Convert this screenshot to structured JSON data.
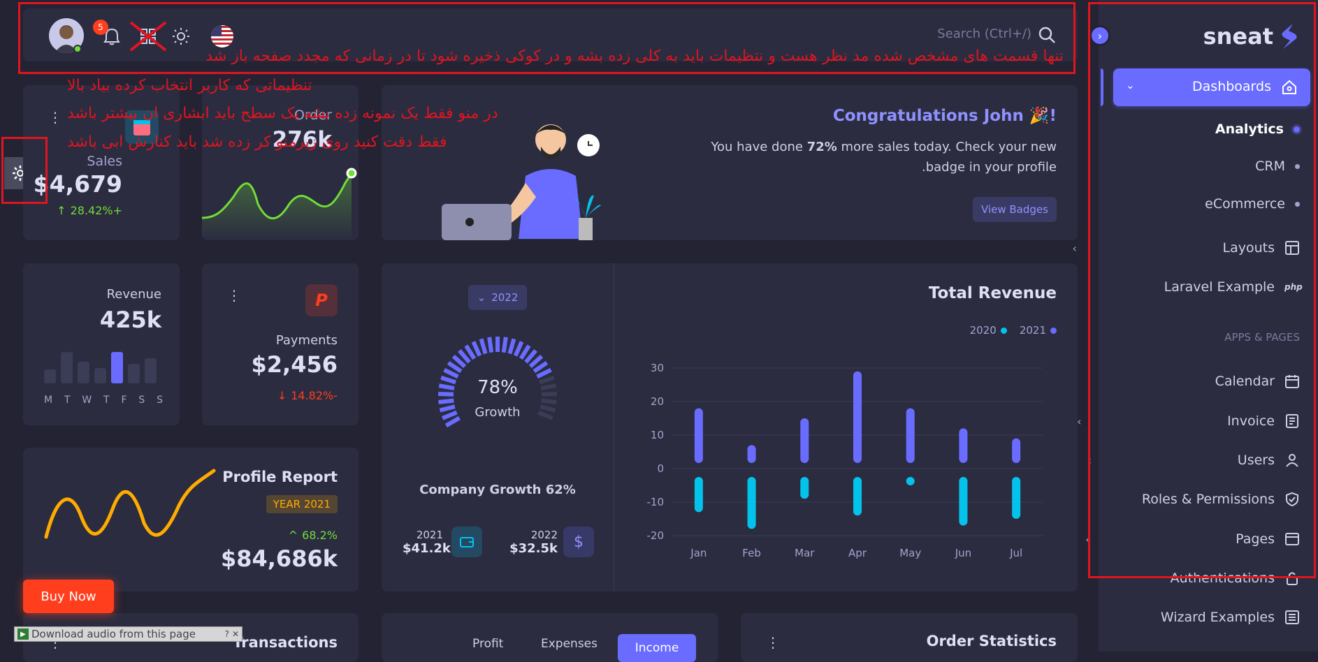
{
  "header": {
    "search_placeholder": "Search (Ctrl+/)",
    "notification_count": "5"
  },
  "annotations": {
    "line1": "تنها قسمت های مشخص شده مد نظر هست و نتظیمات باید به کلی زده بشه و در کوکی ذخیره شود تا در زمانی که مجدد صفحه باز شد",
    "line2": "تنظیماتی که کاربر انتخاب کرده بیاد بالا",
    "line3": "در منو فقط یک نمونه زده بشه یک سطح باید ابشاری ان بیشتر باشد",
    "line4": "فقط دقت کنید روی زیرمنو کر زده شد باید کنارش ابی باشد"
  },
  "sidebar": {
    "brand": "sneat",
    "section_apps": "APPS & PAGES",
    "items": [
      {
        "label": "Dashboards"
      },
      {
        "label": "Analytics"
      },
      {
        "label": "CRM"
      },
      {
        "label": "eCommerce"
      },
      {
        "label": "Layouts"
      },
      {
        "label": "Laravel Example",
        "badge": "php"
      },
      {
        "label": "Calendar"
      },
      {
        "label": "Invoice"
      },
      {
        "label": "Users"
      },
      {
        "label": "Roles & Permissions"
      },
      {
        "label": "Pages"
      },
      {
        "label": "Authentications"
      },
      {
        "label": "Wizard Examples"
      }
    ]
  },
  "congrats": {
    "title": "Congratulations John 🎉!",
    "body_pre": "You have done ",
    "body_bold": "72%",
    "body_post": " more sales today. Check your new",
    "body_line2": ".badge in your profile",
    "button": "View Badges"
  },
  "sales": {
    "label": "Sales",
    "value": "$4,679",
    "change": "28.42%+"
  },
  "order": {
    "label": "Order",
    "value": "276k"
  },
  "revenue_card": {
    "label": "Revenue",
    "value": "425k",
    "days": [
      "M",
      "T",
      "W",
      "T",
      "F",
      "S",
      "S"
    ],
    "bars": [
      0.35,
      0.8,
      0.55,
      0.4,
      0.8,
      0.5,
      0.65
    ]
  },
  "payments": {
    "label": "Payments",
    "value": "$2,456",
    "change": "14.82%-"
  },
  "growth": {
    "year_button": "2022",
    "percent": "78%",
    "percent_label": "Growth",
    "caption": "Company Growth 62%",
    "y2021_label": "2021",
    "y2021_value": "$41.2k",
    "y2022_label": "2022",
    "y2022_value": "$32.5k",
    "progress": 0.78
  },
  "total_revenue": {
    "title": "Total Revenue"
  },
  "chart_data": {
    "type": "bar",
    "title": "Total Revenue",
    "categories": [
      "Jan",
      "Feb",
      "Mar",
      "Apr",
      "May",
      "Jun",
      "Jul"
    ],
    "series": [
      {
        "name": "2021",
        "values": [
          18,
          7,
          15,
          29,
          18,
          12,
          9
        ],
        "color": "#696cff"
      },
      {
        "name": "2020",
        "values": [
          -13,
          -18,
          -9,
          -14,
          -5,
          -17,
          -15
        ],
        "color": "#03c3ec"
      }
    ],
    "yticks": [
      "30",
      "20",
      "10",
      "0",
      "-10",
      "-20"
    ],
    "ylim": [
      -20,
      30
    ],
    "legend_position": "top-right",
    "grid": true
  },
  "profile_report": {
    "title": "Profile Report",
    "badge": "YEAR 2021",
    "change": "68.2%",
    "value": "$84,686k"
  },
  "buy_now": "Buy Now",
  "bottom": {
    "transactions": "Transactions",
    "tabs": [
      "Profit",
      "Expenses",
      "Income"
    ],
    "order_statistics": "Order Statistics",
    "download_bar": "Download audio from this page"
  },
  "colors": {
    "primary": "#696cff",
    "info": "#03c3ec",
    "success": "#71dd37",
    "danger": "#ff3e1d",
    "warning": "#ffab00",
    "annotation": "#e0151f"
  }
}
